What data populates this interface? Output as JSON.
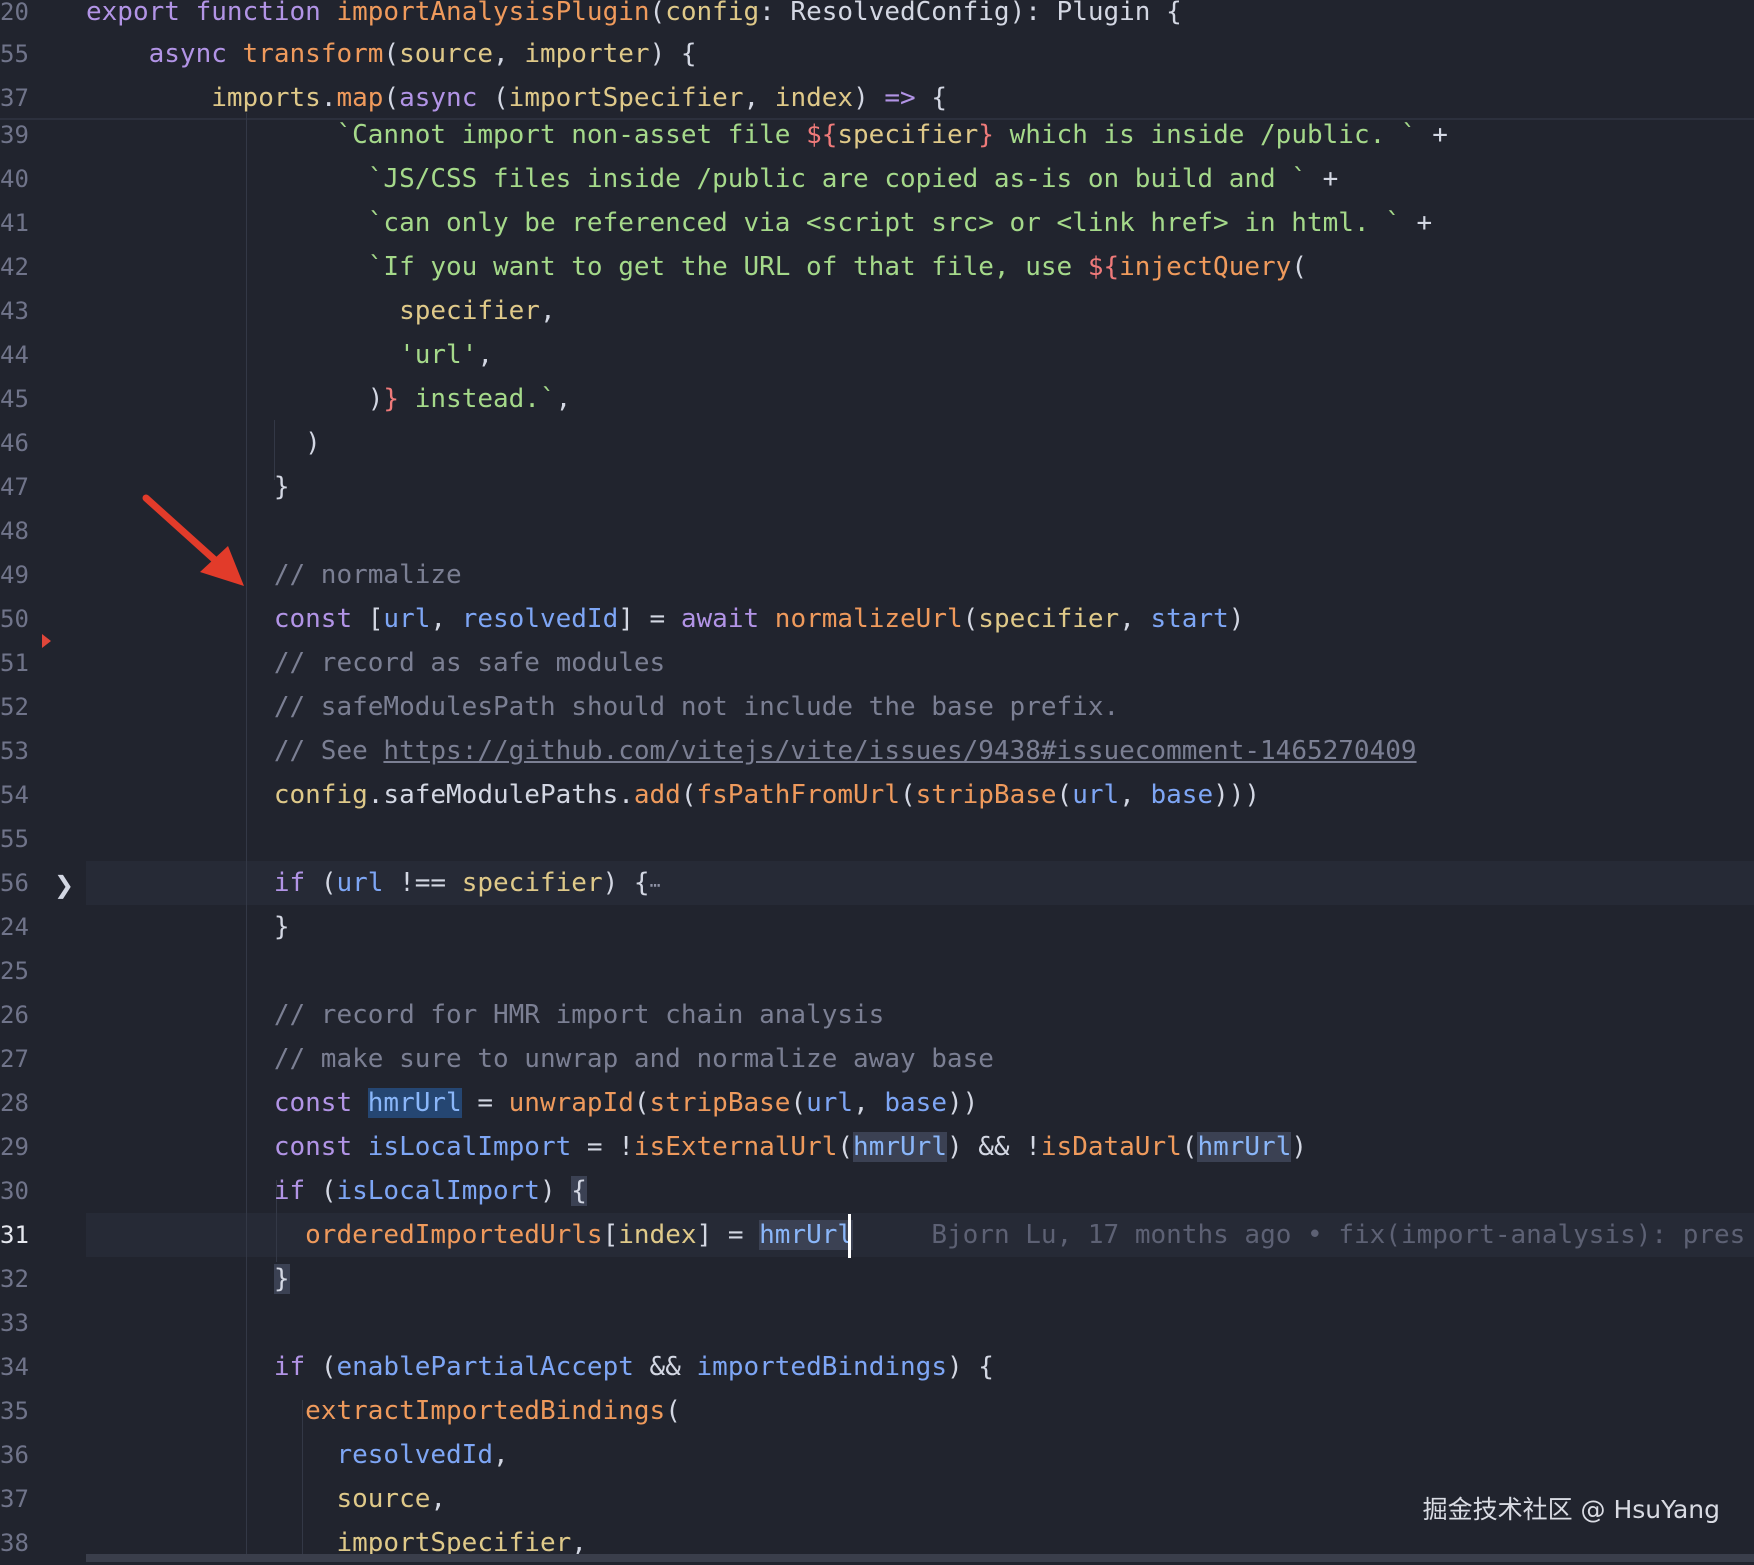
{
  "colors": {
    "background": "#21242e",
    "keyword": "#b294e6",
    "function": "#ef9a5c",
    "variable": "#dfc989",
    "property": "#7ea6f5",
    "string": "#a5d98a",
    "comment": "#7b7f93",
    "highlight": "#254672"
  },
  "editor": {
    "lines": [
      {
        "num": "20",
        "tokens": [
          [
            "kw",
            "export "
          ],
          [
            "kw",
            "function "
          ],
          [
            "fn",
            "importAnalysisPlugin"
          ],
          [
            "punc",
            "("
          ],
          [
            "var",
            "config"
          ],
          [
            "punc",
            ": ResolvedConfig): Plugin {"
          ]
        ]
      },
      {
        "num": "55",
        "tokens": [
          [
            "punc",
            "    "
          ],
          [
            "kw",
            "async "
          ],
          [
            "fn",
            "transform"
          ],
          [
            "punc",
            "("
          ],
          [
            "var",
            "source"
          ],
          [
            "punc",
            ", "
          ],
          [
            "var",
            "importer"
          ],
          [
            "punc",
            ") {"
          ]
        ]
      },
      {
        "num": "37",
        "tokens": [
          [
            "punc",
            "        "
          ],
          [
            "var",
            "imports"
          ],
          [
            "punc",
            "."
          ],
          [
            "fn",
            "map"
          ],
          [
            "punc",
            "("
          ],
          [
            "kw",
            "async "
          ],
          [
            "punc",
            "("
          ],
          [
            "var",
            "importSpecifier"
          ],
          [
            "punc",
            ", "
          ],
          [
            "var",
            "index"
          ],
          [
            "punc",
            ") "
          ],
          [
            "kw",
            "=>"
          ],
          [
            "punc",
            " {"
          ]
        ]
      },
      {
        "num": "39",
        "tokens": [
          [
            "punc",
            "                "
          ],
          [
            "str",
            "`Cannot import non-asset file "
          ],
          [
            "interp",
            "${"
          ],
          [
            "var",
            "specifier"
          ],
          [
            "interp",
            "}"
          ],
          [
            "str",
            " which is inside /public. `"
          ],
          [
            "punc",
            " +"
          ]
        ]
      },
      {
        "num": "40",
        "tokens": [
          [
            "punc",
            "                  "
          ],
          [
            "str",
            "`JS/CSS files inside /public are copied as-is on build and `"
          ],
          [
            "punc",
            " +"
          ]
        ]
      },
      {
        "num": "41",
        "tokens": [
          [
            "punc",
            "                  "
          ],
          [
            "str",
            "`can only be referenced via <script src> or <link href> in html. `"
          ],
          [
            "punc",
            " +"
          ]
        ]
      },
      {
        "num": "42",
        "tokens": [
          [
            "punc",
            "                  "
          ],
          [
            "str",
            "`If you want to get the URL of that file, use "
          ],
          [
            "interp",
            "${"
          ],
          [
            "fn",
            "injectQuery"
          ],
          [
            "punc",
            "("
          ]
        ]
      },
      {
        "num": "43",
        "tokens": [
          [
            "punc",
            "                    "
          ],
          [
            "var",
            "specifier"
          ],
          [
            "punc",
            ","
          ]
        ]
      },
      {
        "num": "44",
        "tokens": [
          [
            "punc",
            "                    "
          ],
          [
            "str",
            "'url'"
          ],
          [
            "punc",
            ","
          ]
        ]
      },
      {
        "num": "45",
        "tokens": [
          [
            "punc",
            "                  )"
          ],
          [
            "interp",
            "}"
          ],
          [
            "str",
            " instead.`"
          ],
          [
            "punc",
            ","
          ]
        ]
      },
      {
        "num": "46",
        "tokens": [
          [
            "punc",
            "              )"
          ]
        ]
      },
      {
        "num": "47",
        "tokens": [
          [
            "punc",
            "            }"
          ]
        ]
      },
      {
        "num": "48",
        "tokens": []
      },
      {
        "num": "49",
        "tokens": [
          [
            "punc",
            "            "
          ],
          [
            "cmt",
            "// normalize"
          ]
        ]
      },
      {
        "num": "50",
        "tokens": [
          [
            "punc",
            "            "
          ],
          [
            "kw",
            "const "
          ],
          [
            "punc",
            "["
          ],
          [
            "prop",
            "url"
          ],
          [
            "punc",
            ", "
          ],
          [
            "prop",
            "resolvedId"
          ],
          [
            "punc",
            "] = "
          ],
          [
            "kw",
            "await "
          ],
          [
            "fn",
            "normalizeUrl"
          ],
          [
            "punc",
            "("
          ],
          [
            "var",
            "specifier"
          ],
          [
            "punc",
            ", "
          ],
          [
            "prop",
            "start"
          ],
          [
            "punc",
            ")"
          ]
        ]
      },
      {
        "num": "51",
        "tokens": [
          [
            "punc",
            "            "
          ],
          [
            "cmt",
            "// record as safe modules"
          ]
        ]
      },
      {
        "num": "52",
        "tokens": [
          [
            "punc",
            "            "
          ],
          [
            "cmt",
            "// safeModulesPath should not include the base prefix."
          ]
        ]
      },
      {
        "num": "53",
        "tokens": [
          [
            "punc",
            "            "
          ],
          [
            "cmt",
            "// See "
          ],
          [
            "link",
            "https://github.com/vitejs/vite/issues/9438#issuecomment-1465270409"
          ]
        ]
      },
      {
        "num": "54",
        "tokens": [
          [
            "punc",
            "            "
          ],
          [
            "var",
            "config"
          ],
          [
            "punc",
            ".safeModulePaths."
          ],
          [
            "fn",
            "add"
          ],
          [
            "punc",
            "("
          ],
          [
            "fn",
            "fsPathFromUrl"
          ],
          [
            "punc",
            "("
          ],
          [
            "fn",
            "stripBase"
          ],
          [
            "punc",
            "("
          ],
          [
            "prop",
            "url"
          ],
          [
            "punc",
            ", "
          ],
          [
            "prop",
            "base"
          ],
          [
            "punc",
            ")))"
          ]
        ]
      },
      {
        "num": "55",
        "tokens": []
      },
      {
        "num": "56",
        "tokens": [
          [
            "punc",
            "            "
          ],
          [
            "kw",
            "if "
          ],
          [
            "punc",
            "("
          ],
          [
            "prop",
            "url"
          ],
          [
            "punc",
            " !== "
          ],
          [
            "var",
            "specifier"
          ],
          [
            "punc",
            ") {"
          ],
          [
            "ellip",
            "⋯"
          ]
        ]
      },
      {
        "num": "24",
        "tokens": [
          [
            "punc",
            "            }"
          ]
        ]
      },
      {
        "num": "25",
        "tokens": []
      },
      {
        "num": "26",
        "tokens": [
          [
            "punc",
            "            "
          ],
          [
            "cmt",
            "// record for HMR import chain analysis"
          ]
        ]
      },
      {
        "num": "27",
        "tokens": [
          [
            "punc",
            "            "
          ],
          [
            "cmt",
            "// make sure to unwrap and normalize away base"
          ]
        ]
      },
      {
        "num": "28",
        "tokens": [
          [
            "punc",
            "            "
          ],
          [
            "kw",
            "const "
          ],
          [
            "hl",
            "hmrUrl"
          ],
          [
            "punc",
            " = "
          ],
          [
            "fn",
            "unwrapId"
          ],
          [
            "punc",
            "("
          ],
          [
            "fn",
            "stripBase"
          ],
          [
            "punc",
            "("
          ],
          [
            "prop",
            "url"
          ],
          [
            "punc",
            ", "
          ],
          [
            "prop",
            "base"
          ],
          [
            "punc",
            "))"
          ]
        ]
      },
      {
        "num": "29",
        "tokens": [
          [
            "punc",
            "            "
          ],
          [
            "kw",
            "const "
          ],
          [
            "prop",
            "isLocalImport"
          ],
          [
            "punc",
            " = !"
          ],
          [
            "fn",
            "isExternalUrl"
          ],
          [
            "punc",
            "("
          ],
          [
            "hl2",
            "hmrUrl"
          ],
          [
            "punc",
            ") && !"
          ],
          [
            "fn",
            "isDataUrl"
          ],
          [
            "punc",
            "("
          ],
          [
            "hl2",
            "hmrUrl"
          ],
          [
            "punc",
            ")"
          ]
        ]
      },
      {
        "num": "30",
        "tokens": [
          [
            "punc",
            "            "
          ],
          [
            "kw",
            "if "
          ],
          [
            "punc",
            "("
          ],
          [
            "prop",
            "isLocalImport"
          ],
          [
            "punc",
            ") "
          ],
          [
            "brm",
            "{"
          ]
        ]
      },
      {
        "num": "31",
        "tokens": [
          [
            "punc",
            "              "
          ],
          [
            "fn",
            "orderedImportedUrls"
          ],
          [
            "punc",
            "["
          ],
          [
            "var",
            "index"
          ],
          [
            "punc",
            "] = "
          ],
          [
            "hl2",
            "hmrUrl"
          ],
          [
            "punc",
            "     "
          ],
          [
            "blame",
            "Bjorn Lu, 17 months ago • fix(import-analysis): pres"
          ]
        ]
      },
      {
        "num": "32",
        "tokens": [
          [
            "punc",
            "            "
          ],
          [
            "brm",
            "}"
          ]
        ]
      },
      {
        "num": "33",
        "tokens": []
      },
      {
        "num": "34",
        "tokens": [
          [
            "punc",
            "            "
          ],
          [
            "kw",
            "if "
          ],
          [
            "punc",
            "("
          ],
          [
            "prop",
            "enablePartialAccept"
          ],
          [
            "punc",
            " && "
          ],
          [
            "prop",
            "importedBindings"
          ],
          [
            "punc",
            ") {"
          ]
        ]
      },
      {
        "num": "35",
        "tokens": [
          [
            "punc",
            "              "
          ],
          [
            "fn",
            "extractImportedBindings"
          ],
          [
            "punc",
            "("
          ]
        ]
      },
      {
        "num": "36",
        "tokens": [
          [
            "punc",
            "                "
          ],
          [
            "prop",
            "resolvedId"
          ],
          [
            "punc",
            ","
          ]
        ]
      },
      {
        "num": "37",
        "tokens": [
          [
            "punc",
            "                "
          ],
          [
            "var",
            "source"
          ],
          [
            "punc",
            ","
          ]
        ]
      },
      {
        "num": "38",
        "tokens": [
          [
            "punc",
            "                "
          ],
          [
            "var",
            "importSpecifier"
          ],
          [
            "punc",
            ","
          ]
        ]
      }
    ]
  },
  "watermark": "掘金技术社区 @ HsuYang"
}
